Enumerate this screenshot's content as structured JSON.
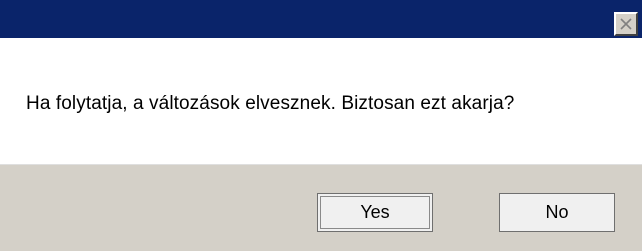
{
  "window": {
    "title": "",
    "close_icon": "close-icon"
  },
  "dialog": {
    "message": "Ha folytatja, a változások elvesznek. Biztosan ezt akarja?"
  },
  "buttons": {
    "yes_label": "Yes",
    "no_label": "No"
  },
  "colors": {
    "titlebar": "#0a246a",
    "content_bg": "#ffffff",
    "footer_bg": "#d4d0c8",
    "button_bg": "#f0f0f0"
  }
}
